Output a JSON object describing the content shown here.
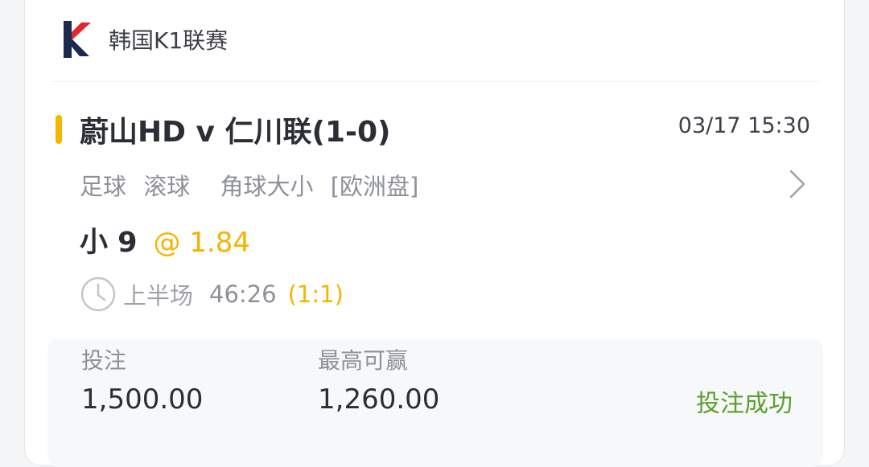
{
  "league": {
    "name": "韩国K1联赛",
    "logo_icon": "k-league-logo"
  },
  "match": {
    "title": "蔚山HD v 仁川联(1-0)",
    "datetime": "03/17 15:30",
    "sport": "足球",
    "mode": "滚球",
    "market": "角球大小",
    "odds_format": "[欧洲盘]"
  },
  "selection": {
    "pick": "小 9",
    "odds": "@ 1.84"
  },
  "live": {
    "clock_icon": "clock-icon",
    "period": "上半场",
    "game_clock": "46:26",
    "score": "(1:1)"
  },
  "bet": {
    "stake_label": "投注",
    "stake_value": "1,500.00",
    "max_win_label": "最高可赢",
    "max_win_value": "1,260.00",
    "status": "投注成功"
  },
  "colors": {
    "accent": "#f5b400",
    "success": "#5aa02c",
    "logo_dark": "#1d2a4f",
    "logo_red": "#e3262e"
  }
}
